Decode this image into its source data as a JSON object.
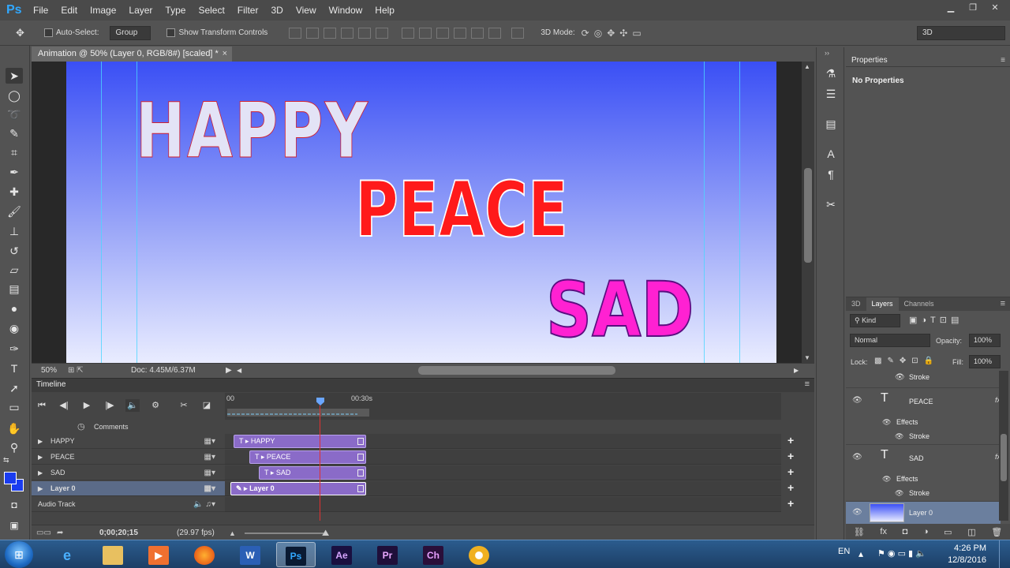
{
  "app": {
    "logo": "Ps",
    "menu": [
      "File",
      "Edit",
      "Image",
      "Layer",
      "Type",
      "Select",
      "Filter",
      "3D",
      "View",
      "Window",
      "Help"
    ],
    "window_controls": [
      "minimize",
      "restore",
      "close"
    ]
  },
  "options": {
    "auto_select_label": "Auto-Select:",
    "auto_select_value": "Group",
    "show_transform_label": "Show Transform Controls",
    "mode3d_label": "3D Mode:",
    "workspace": "3D"
  },
  "document": {
    "tab_title": "Animation @ 50% (Layer 0, RGB/8#) [scaled] *",
    "zoom": "50%",
    "doc_size": "Doc: 4.45M/6.37M",
    "canvas_words": {
      "happy": "HAPPY",
      "peace": "PEACE",
      "sad": "SAD"
    },
    "colors": {
      "peace": "#ff1a1a",
      "sad": "#ff21d2",
      "happy": "#e3e3f6"
    }
  },
  "timeline": {
    "title": "Timeline",
    "ruler_start": "00",
    "ruler_end": "00:30s",
    "comments_label": "Comments",
    "tracks": [
      {
        "name": "HAPPY",
        "clip": "HAPPY",
        "type": "T"
      },
      {
        "name": "PEACE",
        "clip": "PEACE",
        "type": "T"
      },
      {
        "name": "SAD",
        "clip": "SAD",
        "type": "T"
      },
      {
        "name": "Layer 0",
        "clip": "Layer 0",
        "type": "brush"
      }
    ],
    "audio_track": "Audio Track",
    "timecode": "0;00;20;15",
    "fps": "(29.97 fps)"
  },
  "properties": {
    "tab": "Properties",
    "message": "No Properties"
  },
  "layers": {
    "tabs": [
      "3D",
      "Layers",
      "Channels"
    ],
    "kind_label": "Kind",
    "blend_mode": "Normal",
    "opacity_label": "Opacity:",
    "opacity_value": "100%",
    "lock_label": "Lock:",
    "fill_label": "Fill:",
    "fill_value": "100%",
    "top_stroke": "Stroke",
    "items": [
      {
        "name": "PEACE",
        "effects": "Effects",
        "stroke": "Stroke",
        "fx": "fx"
      },
      {
        "name": "SAD",
        "effects": "Effects",
        "stroke": "Stroke",
        "fx": "fx"
      },
      {
        "name": "Layer 0"
      }
    ]
  },
  "taskbar": {
    "apps": [
      "ie",
      "explorer",
      "media",
      "firefox",
      "W",
      "Ps",
      "Ae",
      "Pr",
      "Ch",
      "camtasia"
    ],
    "lang": "EN",
    "time": "4:26 PM",
    "date": "12/8/2016"
  }
}
